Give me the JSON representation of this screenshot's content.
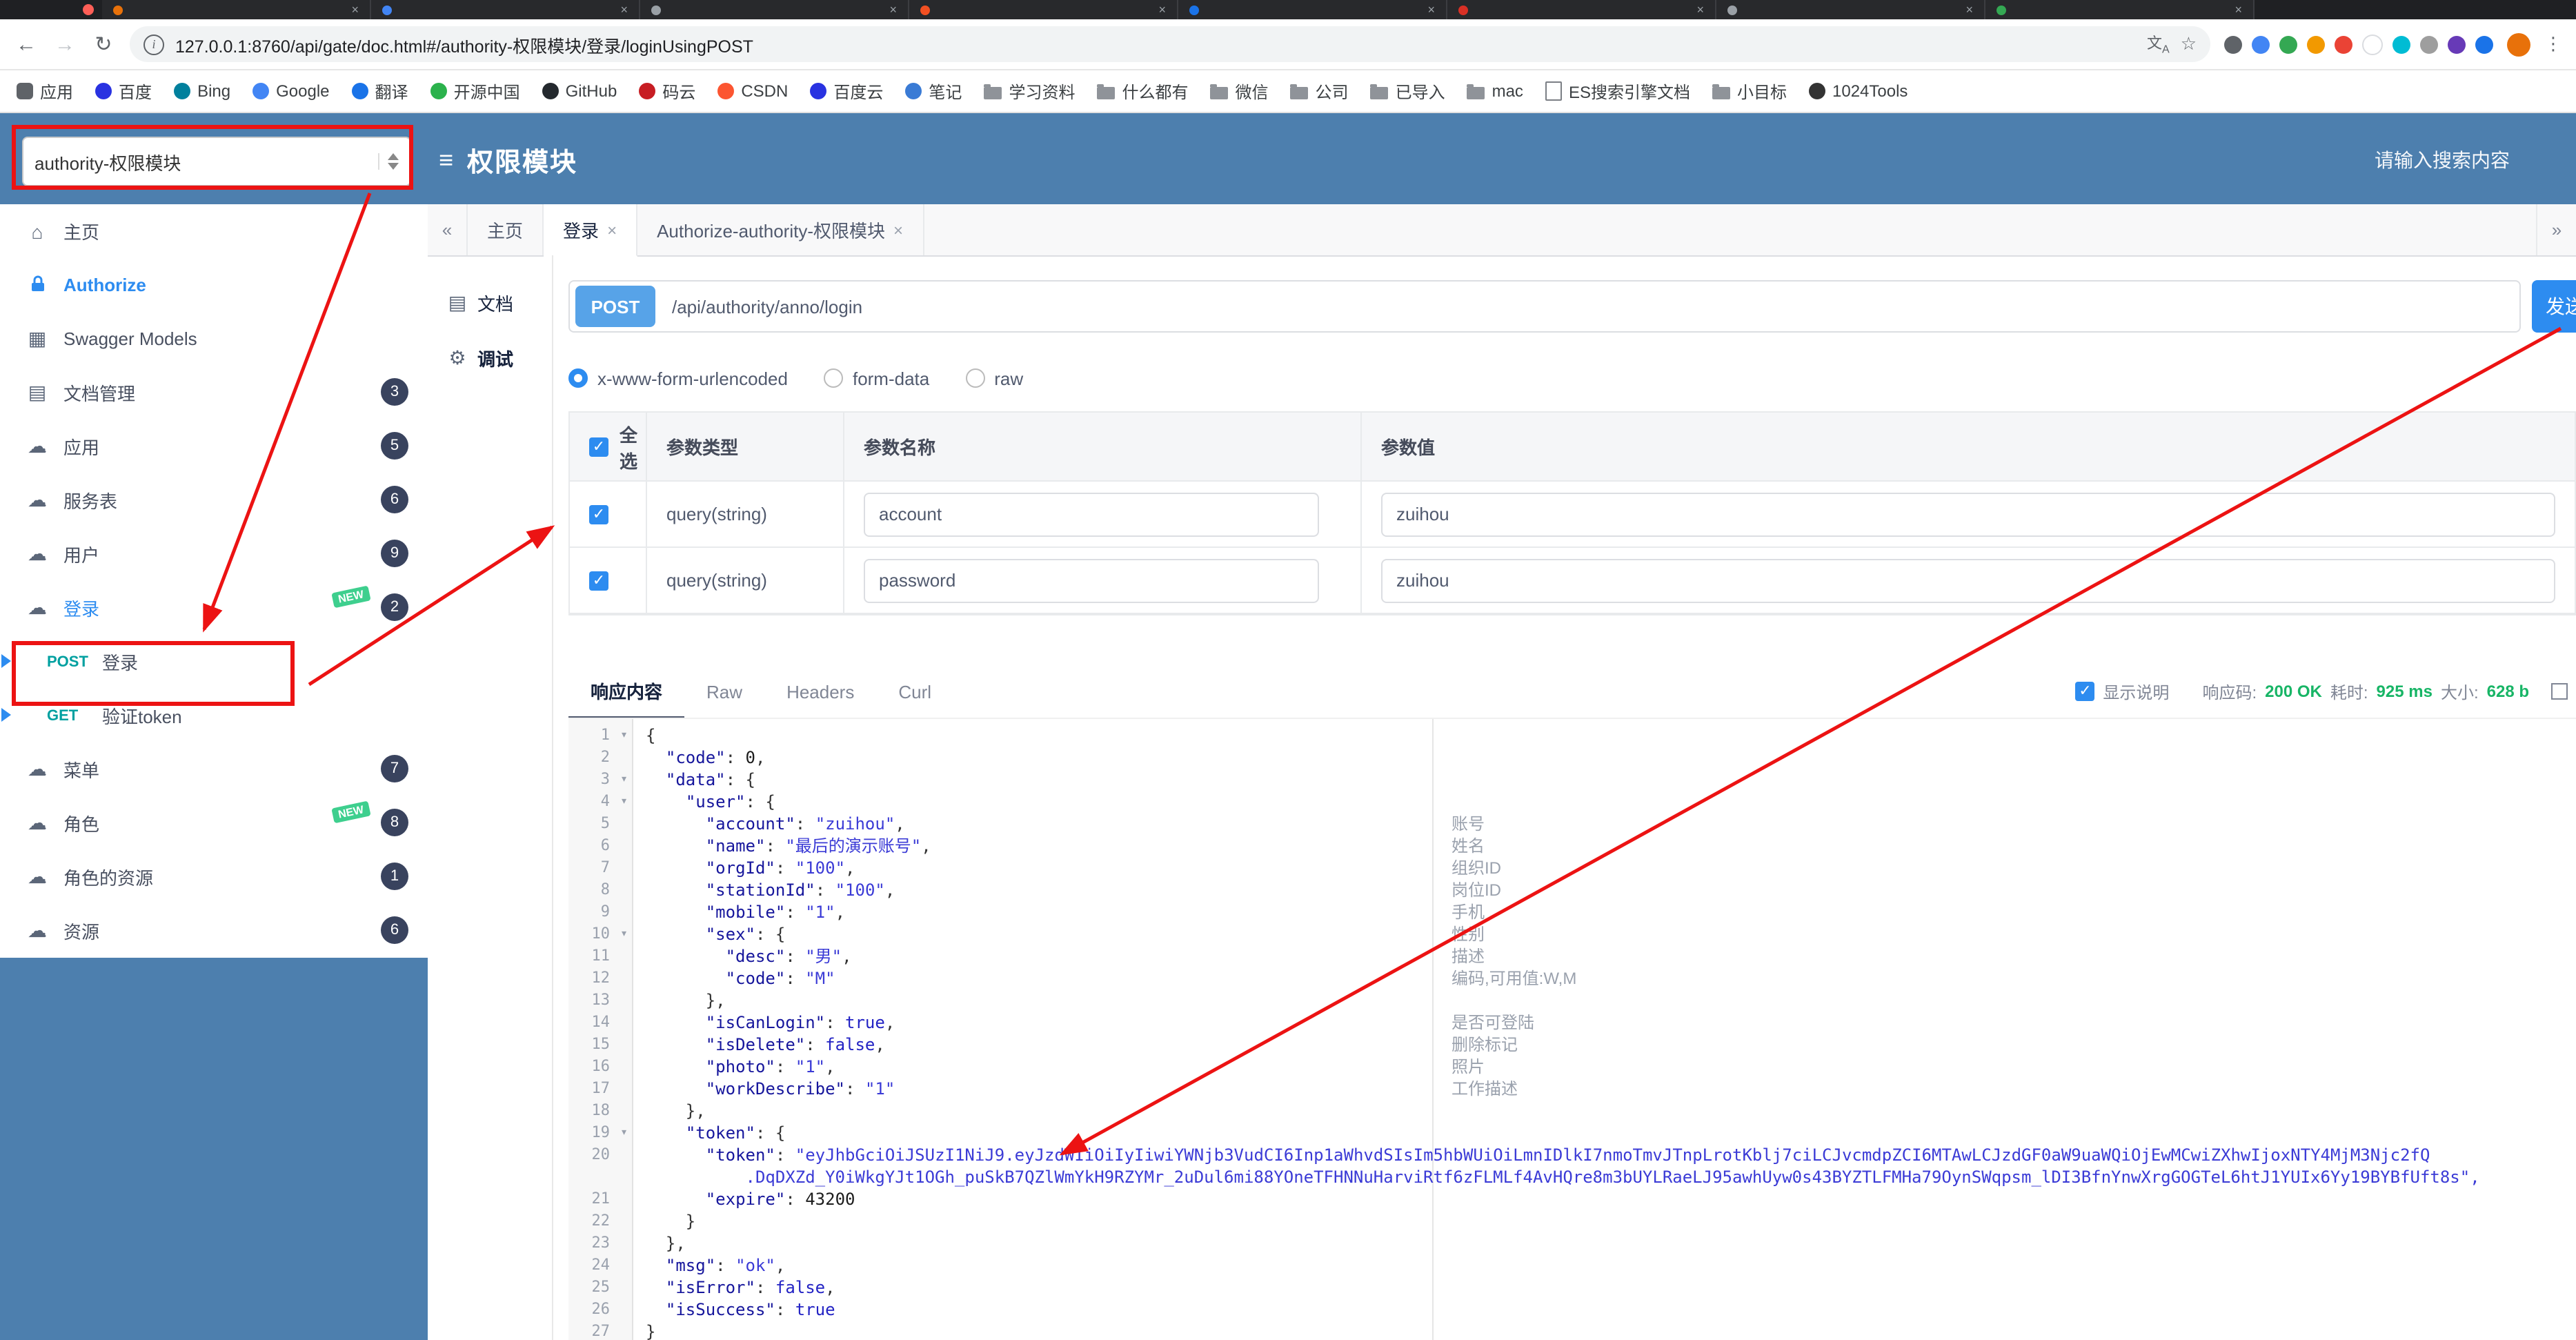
{
  "browser": {
    "window_controls": [
      "close"
    ],
    "tab_favicons": [
      "#e8710a",
      "#4285f4",
      "#9aa0a6",
      "#f25022",
      "#1a73e8",
      "#d93025",
      "#9aa0a6",
      "#34a853"
    ],
    "url": "127.0.0.1:8760/api/gate/doc.html#/authority-权限模块/登录/loginUsingPOST",
    "extension_colors": [
      "#5f6368",
      "#4285f4",
      "#34a853",
      "#f29900",
      "#ea4335",
      "#ffffff",
      "#00bcd4",
      "#9e9e9e",
      "#673ab7",
      "#1a73e8"
    ],
    "bookmarks": [
      {
        "label": "应用",
        "icon": "grid",
        "color": "#5f6368"
      },
      {
        "label": "百度",
        "icon": "site",
        "color": "#2932e1"
      },
      {
        "label": "Bing",
        "icon": "site",
        "color": "#00809d"
      },
      {
        "label": "Google",
        "icon": "site",
        "color": "#4285f4"
      },
      {
        "label": "翻译",
        "icon": "site",
        "color": "#1a73e8"
      },
      {
        "label": "开源中国",
        "icon": "site",
        "color": "#2bb24c"
      },
      {
        "label": "GitHub",
        "icon": "site",
        "color": "#24292e"
      },
      {
        "label": "码云",
        "icon": "site",
        "color": "#c71d23"
      },
      {
        "label": "CSDN",
        "icon": "site",
        "color": "#fc5531"
      },
      {
        "label": "百度云",
        "icon": "site",
        "color": "#2932e1"
      },
      {
        "label": "笔记",
        "icon": "site",
        "color": "#3a7bd5"
      },
      {
        "label": "学习资料",
        "icon": "folder",
        "color": "#8f9399"
      },
      {
        "label": "什么都有",
        "icon": "folder",
        "color": "#8f9399"
      },
      {
        "label": "微信",
        "icon": "folder",
        "color": "#8f9399"
      },
      {
        "label": "公司",
        "icon": "folder",
        "color": "#8f9399"
      },
      {
        "label": "已导入",
        "icon": "folder",
        "color": "#8f9399"
      },
      {
        "label": "mac",
        "icon": "folder",
        "color": "#8f9399"
      },
      {
        "label": "ES搜索引擎文档",
        "icon": "doc",
        "color": "#7b7f85"
      },
      {
        "label": "小目标",
        "icon": "folder",
        "color": "#8f9399"
      },
      {
        "label": "1024Tools",
        "icon": "site",
        "color": "#333333"
      }
    ]
  },
  "header": {
    "module_select": "authority-权限模块",
    "title": "权限模块",
    "search_placeholder": "请输入搜索内容"
  },
  "sidebar": {
    "new_label": "NEW",
    "items": [
      {
        "label": "主页"
      },
      {
        "label": "Authorize"
      },
      {
        "label": "Swagger Models"
      },
      {
        "label": "文档管理",
        "badge": "3"
      },
      {
        "label": "应用",
        "badge": "5"
      },
      {
        "label": "服务表",
        "badge": "6"
      },
      {
        "label": "用户",
        "badge": "9"
      },
      {
        "label": "登录",
        "badge": "2"
      },
      {
        "label": "登录",
        "method": "POST"
      },
      {
        "label": "验证token",
        "method": "GET"
      },
      {
        "label": "菜单",
        "badge": "7"
      },
      {
        "label": "角色",
        "badge": "8"
      },
      {
        "label": "角色的资源",
        "badge": "1"
      },
      {
        "label": "资源",
        "badge": "6"
      }
    ]
  },
  "content_tabs": {
    "back": "«",
    "forward": "»",
    "items": [
      {
        "label": "主页",
        "closable": false
      },
      {
        "label": "登录",
        "closable": true
      },
      {
        "label": "Authorize-authority-权限模块",
        "closable": true
      }
    ]
  },
  "panel": {
    "doc": "文档",
    "debug": "调试"
  },
  "endpoint": {
    "method": "POST",
    "path": "/api/authority/anno/login",
    "send_label": "发送"
  },
  "body_type": {
    "options": [
      "x-www-form-urlencoded",
      "form-data",
      "raw"
    ],
    "selected": "x-www-form-urlencoded"
  },
  "params_table": {
    "headers": [
      "全选",
      "参数类型",
      "参数名称",
      "参数值"
    ],
    "rows": [
      {
        "type": "query(string)",
        "name": "account",
        "value": "zuihou"
      },
      {
        "type": "query(string)",
        "name": "password",
        "value": "zuihou"
      }
    ]
  },
  "response": {
    "tabs": [
      "响应内容",
      "Raw",
      "Headers",
      "Curl"
    ],
    "active_tab": "响应内容",
    "show_desc_label": "显示说明",
    "meta": {
      "code_label": "响应码:",
      "code": "200 OK",
      "time_label": "耗时:",
      "time": "925 ms",
      "size_label": "大小:",
      "size": "628 b"
    }
  },
  "code": {
    "lines": [
      {
        "n": 1,
        "t": "{",
        "f": true
      },
      {
        "n": 2,
        "t": "  \"code\": 0,"
      },
      {
        "n": 3,
        "t": "  \"data\": {",
        "f": true
      },
      {
        "n": 4,
        "t": "    \"user\": {",
        "f": true
      },
      {
        "n": 5,
        "t": "      \"account\": \"zuihou\",",
        "a": "账号"
      },
      {
        "n": 6,
        "t": "      \"name\": \"最后的演示账号\",",
        "a": "姓名"
      },
      {
        "n": 7,
        "t": "      \"orgId\": \"100\",",
        "a": "组织ID"
      },
      {
        "n": 8,
        "t": "      \"stationId\": \"100\",",
        "a": "岗位ID"
      },
      {
        "n": 9,
        "t": "      \"mobile\": \"1\",",
        "a": "手机"
      },
      {
        "n": 10,
        "t": "      \"sex\": {",
        "f": true,
        "a": "性别"
      },
      {
        "n": 11,
        "t": "        \"desc\": \"男\",",
        "a": "描述"
      },
      {
        "n": 12,
        "t": "        \"code\": \"M\"",
        "a": "编码,可用值:W,M"
      },
      {
        "n": 13,
        "t": "      },"
      },
      {
        "n": 14,
        "t": "      \"isCanLogin\": true,",
        "a": "是否可登陆"
      },
      {
        "n": 15,
        "t": "      \"isDelete\": false,",
        "a": "删除标记"
      },
      {
        "n": 16,
        "t": "      \"photo\": \"1\",",
        "a": "照片"
      },
      {
        "n": 17,
        "t": "      \"workDescribe\": \"1\"",
        "a": "工作描述"
      },
      {
        "n": 18,
        "t": "    },"
      },
      {
        "n": 19,
        "t": "    \"token\": {",
        "f": true
      },
      {
        "n": 20,
        "t": "      \"token\": \"eyJhbGciOiJSUzI1NiJ9.eyJzdWIiOiIyIiwiYWNjb3VudCI6Inp1aWhvdSIsIm5hbWUiOiLmnIDlkI7nmoTmvJTnpLrotKblj7ciLCJvcmdpZCI6MTAwLCJzdGF0aW9uaWQiOjEwMCwiZXhwIjoxNTY4MjM3Njc2fQ"
      },
      {
        "n": "",
        "t": "          .DqDXZd_Y0iWkgYJt1OGh_puSkB7QZlWmYkH9RZYMr_2uDul6mi88YOneTFHNNuHarviRtf6zFLMLf4AvHQre8m3bUYLRaeLJ95awhUyw0s43BYZTLFMHa79OynSWqpsm_lDI3BfnYnwXrgGOGTeL6htJ1YUIx6Yy19BYBfUft8s\",",
        "c": "js"
      },
      {
        "n": 21,
        "t": "      \"expire\": 43200"
      },
      {
        "n": 22,
        "t": "    }"
      },
      {
        "n": 23,
        "t": "  },"
      },
      {
        "n": 24,
        "t": "  \"msg\": \"ok\","
      },
      {
        "n": 25,
        "t": "  \"isError\": false,"
      },
      {
        "n": 26,
        "t": "  \"isSuccess\": true"
      },
      {
        "n": 27,
        "t": "}"
      }
    ]
  }
}
